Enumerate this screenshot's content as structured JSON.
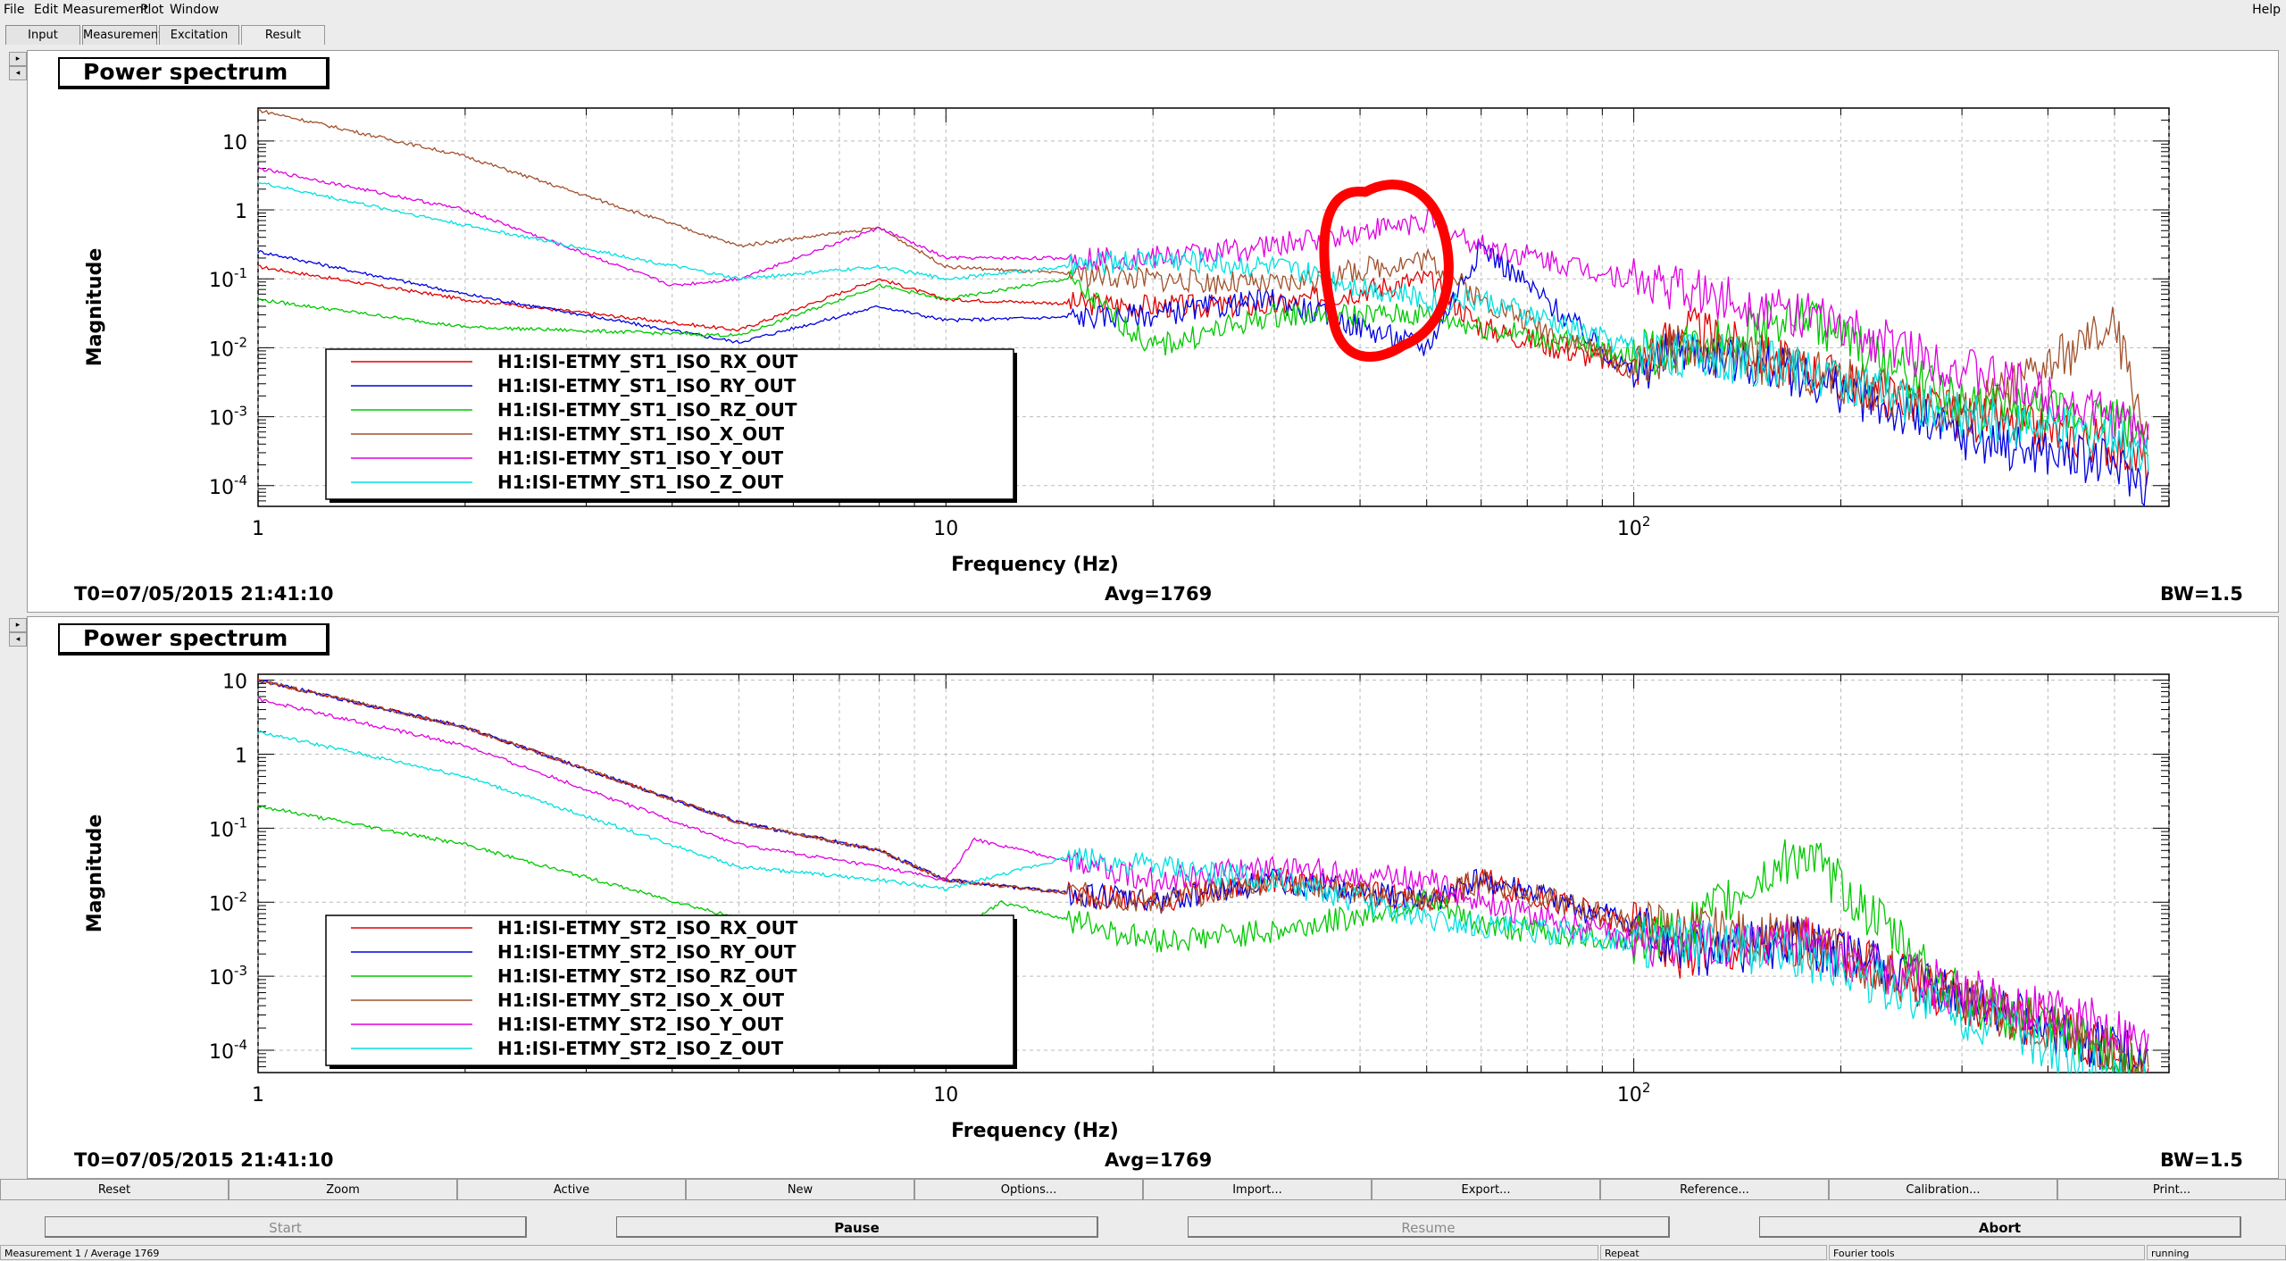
{
  "menu": {
    "file": "File",
    "edit": "Edit",
    "measurement": "Measurement",
    "plot": "Plot",
    "window": "Window",
    "help": "Help"
  },
  "tabs": {
    "input": "Input",
    "measurement": "Measurement",
    "excitation": "Excitation",
    "result": "Result"
  },
  "panels": [
    {
      "title": "Power spectrum",
      "ylabel": "Magnitude",
      "xlabel": "Frequency (Hz)",
      "t0": "T0=07/05/2015 21:41:10",
      "avg": "Avg=1769",
      "bw": "BW=1.5",
      "yticks": [
        "10",
        "1",
        "10-1",
        "10-2",
        "10-3",
        "10-4"
      ],
      "xticks": [
        "1",
        "10",
        "102"
      ],
      "legend": [
        "H1:ISI-ETMY_ST1_ISO_RX_OUT",
        "H1:ISI-ETMY_ST1_ISO_RY_OUT",
        "H1:ISI-ETMY_ST1_ISO_RZ_OUT",
        "H1:ISI-ETMY_ST1_ISO_X_OUT",
        "H1:ISI-ETMY_ST1_ISO_Y_OUT",
        "H1:ISI-ETMY_ST1_ISO_Z_OUT"
      ]
    },
    {
      "title": "Power spectrum",
      "ylabel": "Magnitude",
      "xlabel": "Frequency (Hz)",
      "t0": "T0=07/05/2015 21:41:10",
      "avg": "Avg=1769",
      "bw": "BW=1.5",
      "yticks": [
        "10",
        "1",
        "10-1",
        "10-2",
        "10-3",
        "10-4"
      ],
      "xticks": [
        "1",
        "10",
        "102"
      ],
      "legend": [
        "H1:ISI-ETMY_ST2_ISO_RX_OUT",
        "H1:ISI-ETMY_ST2_ISO_RY_OUT",
        "H1:ISI-ETMY_ST2_ISO_RZ_OUT",
        "H1:ISI-ETMY_ST2_ISO_X_OUT",
        "H1:ISI-ETMY_ST2_ISO_Y_OUT",
        "H1:ISI-ETMY_ST2_ISO_Z_OUT"
      ]
    }
  ],
  "series_colors": [
    "#e00000",
    "#0000e0",
    "#00c800",
    "#a0522d",
    "#e000e0",
    "#00e0e0"
  ],
  "annotation_color": "#ff0000",
  "toolbar": [
    "Reset",
    "Zoom",
    "Active",
    "New",
    "Options...",
    "Import...",
    "Export...",
    "Reference...",
    "Calibration...",
    "Print..."
  ],
  "actions": {
    "start": "Start",
    "pause": "Pause",
    "resume": "Resume",
    "abort": "Abort"
  },
  "statusbar": {
    "measurement": "Measurement 1 / Average 1769",
    "repeat": "Repeat",
    "fourier": "Fourier tools",
    "state": "running"
  },
  "chart_data": [
    {
      "type": "line",
      "title": "Power spectrum",
      "xlabel": "Frequency (Hz)",
      "ylabel": "Magnitude",
      "x_scale": "log",
      "y_scale": "log",
      "xlim": [
        1,
        600
      ],
      "ylim": [
        5e-05,
        30
      ],
      "grid": true,
      "legend_position": "bottom-left",
      "series": [
        {
          "name": "H1:ISI-ETMY_ST1_ISO_RX_OUT",
          "x": [
            1,
            2,
            5,
            8,
            10,
            20,
            30,
            50,
            60,
            100,
            117,
            176,
            300,
            500,
            560
          ],
          "y": [
            0.15,
            0.05,
            0.018,
            0.1,
            0.05,
            0.04,
            0.04,
            0.1,
            0.02,
            0.005,
            0.02,
            0.005,
            0.001,
            0.0004,
            0.0002
          ]
        },
        {
          "name": "H1:ISI-ETMY_ST1_ISO_RY_OUT",
          "x": [
            1,
            2,
            5,
            8,
            10,
            20,
            30,
            50,
            60,
            100,
            117,
            176,
            300,
            500,
            560
          ],
          "y": [
            0.25,
            0.06,
            0.012,
            0.04,
            0.025,
            0.03,
            0.05,
            0.01,
            0.3,
            0.004,
            0.01,
            0.004,
            0.0005,
            0.0002,
            0.0001
          ]
        },
        {
          "name": "H1:ISI-ETMY_ST1_ISO_RZ_OUT",
          "x": [
            1,
            2,
            5,
            8,
            10,
            15,
            20,
            30,
            50,
            60,
            100,
            117,
            176,
            300,
            500,
            560
          ],
          "y": [
            0.05,
            0.02,
            0.015,
            0.08,
            0.05,
            0.1,
            0.01,
            0.03,
            0.03,
            0.02,
            0.008,
            0.01,
            0.03,
            0.0015,
            0.001,
            0.0005
          ]
        },
        {
          "name": "H1:ISI-ETMY_ST1_ISO_X_OUT",
          "x": [
            1,
            2,
            5,
            8,
            10,
            20,
            30,
            50,
            60,
            100,
            117,
            176,
            300,
            500,
            560
          ],
          "y": [
            28,
            6,
            0.3,
            0.55,
            0.15,
            0.1,
            0.08,
            0.2,
            0.05,
            0.005,
            0.01,
            0.005,
            0.001,
            0.02,
            0.0005
          ]
        },
        {
          "name": "H1:ISI-ETMY_ST1_ISO_Y_OUT",
          "x": [
            1,
            2,
            4,
            5,
            8,
            10,
            20,
            30,
            50,
            60,
            100,
            176,
            300,
            500,
            560
          ],
          "y": [
            4,
            1,
            0.08,
            0.1,
            0.55,
            0.2,
            0.2,
            0.3,
            0.7,
            0.3,
            0.1,
            0.03,
            0.005,
            0.001,
            0.0005
          ]
        },
        {
          "name": "H1:ISI-ETMY_ST1_ISO_Z_OUT",
          "x": [
            1,
            2,
            5,
            8,
            10,
            20,
            30,
            50,
            60,
            100,
            176,
            300,
            500,
            560
          ],
          "y": [
            2.5,
            0.6,
            0.1,
            0.15,
            0.1,
            0.2,
            0.15,
            0.05,
            0.05,
            0.01,
            0.005,
            0.001,
            0.0005,
            0.0003
          ]
        }
      ]
    },
    {
      "type": "line",
      "title": "Power spectrum",
      "xlabel": "Frequency (Hz)",
      "ylabel": "Magnitude",
      "x_scale": "log",
      "y_scale": "log",
      "xlim": [
        1,
        600
      ],
      "ylim": [
        5e-05,
        12
      ],
      "grid": true,
      "legend_position": "bottom-left",
      "series": [
        {
          "name": "H1:ISI-ETMY_ST2_ISO_RX_OUT",
          "x": [
            1,
            2,
            5,
            8,
            10,
            20,
            30,
            50,
            60,
            100,
            117,
            176,
            300,
            500,
            560
          ],
          "y": [
            10,
            2.3,
            0.12,
            0.05,
            0.02,
            0.01,
            0.02,
            0.01,
            0.02,
            0.005,
            0.002,
            0.003,
            0.0005,
            0.0001,
            6e-05
          ]
        },
        {
          "name": "H1:ISI-ETMY_ST2_ISO_RY_OUT",
          "x": [
            1,
            2,
            5,
            8,
            10,
            20,
            30,
            50,
            60,
            100,
            117,
            176,
            300,
            500,
            560
          ],
          "y": [
            10,
            2.3,
            0.12,
            0.05,
            0.02,
            0.01,
            0.02,
            0.01,
            0.02,
            0.005,
            0.002,
            0.003,
            0.0005,
            0.0001,
            6e-05
          ]
        },
        {
          "name": "H1:ISI-ETMY_ST2_ISO_RZ_OUT",
          "x": [
            1,
            2,
            5,
            8,
            10,
            12,
            20,
            30,
            50,
            60,
            100,
            117,
            176,
            300,
            500,
            560
          ],
          "y": [
            0.2,
            0.06,
            0.006,
            0.003,
            0.003,
            0.01,
            0.003,
            0.004,
            0.01,
            0.005,
            0.003,
            0.004,
            0.05,
            0.0005,
            0.0001,
            5e-05
          ]
        },
        {
          "name": "H1:ISI-ETMY_ST2_ISO_X_OUT",
          "x": [
            1,
            2,
            5,
            8,
            10,
            20,
            30,
            50,
            60,
            100,
            176,
            300,
            500,
            560
          ],
          "y": [
            10,
            2.3,
            0.12,
            0.05,
            0.02,
            0.01,
            0.02,
            0.01,
            0.02,
            0.005,
            0.003,
            0.0005,
            0.0001,
            6e-05
          ]
        },
        {
          "name": "H1:ISI-ETMY_ST2_ISO_Y_OUT",
          "x": [
            1,
            2,
            5,
            8,
            10,
            11,
            20,
            30,
            50,
            60,
            100,
            176,
            300,
            500,
            560
          ],
          "y": [
            5.5,
            1.3,
            0.06,
            0.03,
            0.02,
            0.07,
            0.02,
            0.03,
            0.02,
            0.01,
            0.003,
            0.003,
            0.0006,
            0.0002,
            0.0001
          ]
        },
        {
          "name": "H1:ISI-ETMY_ST2_ISO_Z_OUT",
          "x": [
            1,
            2,
            5,
            8,
            10,
            15,
            20,
            30,
            50,
            60,
            100,
            176,
            300,
            500,
            560
          ],
          "y": [
            2,
            0.5,
            0.03,
            0.02,
            0.015,
            0.04,
            0.03,
            0.02,
            0.006,
            0.005,
            0.003,
            0.002,
            0.0003,
            5e-05,
            3e-05
          ]
        }
      ]
    }
  ]
}
